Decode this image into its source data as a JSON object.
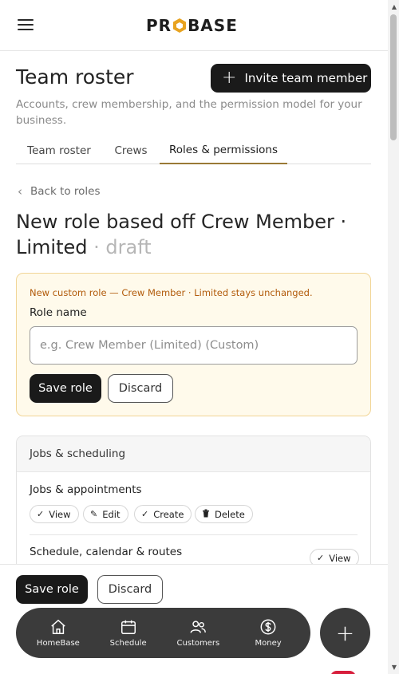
{
  "header": {
    "logo_text": "PROBASE",
    "menu_icon": "hamburger-icon"
  },
  "page": {
    "title": "Team roster",
    "subtitle": "Accounts, crew membership, and the permission model for your business.",
    "invite_label": "Invite team member"
  },
  "tabs": [
    {
      "label": "Team roster",
      "active": false
    },
    {
      "label": "Crews",
      "active": false
    },
    {
      "label": "Roles & permissions",
      "active": true
    }
  ],
  "role": {
    "back_label": "Back to roles",
    "title": "New role based off Crew Member · Limited",
    "status": "· draft",
    "notice": "New custom role — Crew Member · Limited stays unchanged.",
    "name_label": "Role name",
    "name_value": "",
    "name_placeholder": "e.g. Crew Member (Limited) (Custom)",
    "save_label": "Save role",
    "discard_label": "Discard"
  },
  "permissions": {
    "section_title": "Jobs & scheduling",
    "rows": [
      {
        "title": "Jobs & appointments",
        "actions": [
          {
            "label": "View",
            "icon": "check-icon"
          },
          {
            "label": "Edit",
            "icon": "pencil-icon"
          },
          {
            "label": "Create",
            "icon": "check-icon"
          },
          {
            "label": "Delete",
            "icon": "trash-icon"
          }
        ]
      },
      {
        "title": "Schedule, calendar & routes",
        "actions": [
          {
            "label": "View",
            "icon": "check-icon"
          }
        ]
      }
    ]
  },
  "sticky": {
    "save_label": "Save role",
    "discard_label": "Discard"
  },
  "nav": [
    {
      "label": "HomeBase",
      "icon": "home-icon"
    },
    {
      "label": "Schedule",
      "icon": "calendar-icon"
    },
    {
      "label": "Customers",
      "icon": "users-icon"
    },
    {
      "label": "Money",
      "icon": "dollar-icon"
    }
  ],
  "fab_icon": "plus-icon",
  "colors": {
    "accent": "#9a7a36",
    "notice_bg": "#fffaeb",
    "notice_text": "#b25b0b",
    "nav_bg": "#3b3b3b",
    "primary": "#1a1a1a"
  }
}
